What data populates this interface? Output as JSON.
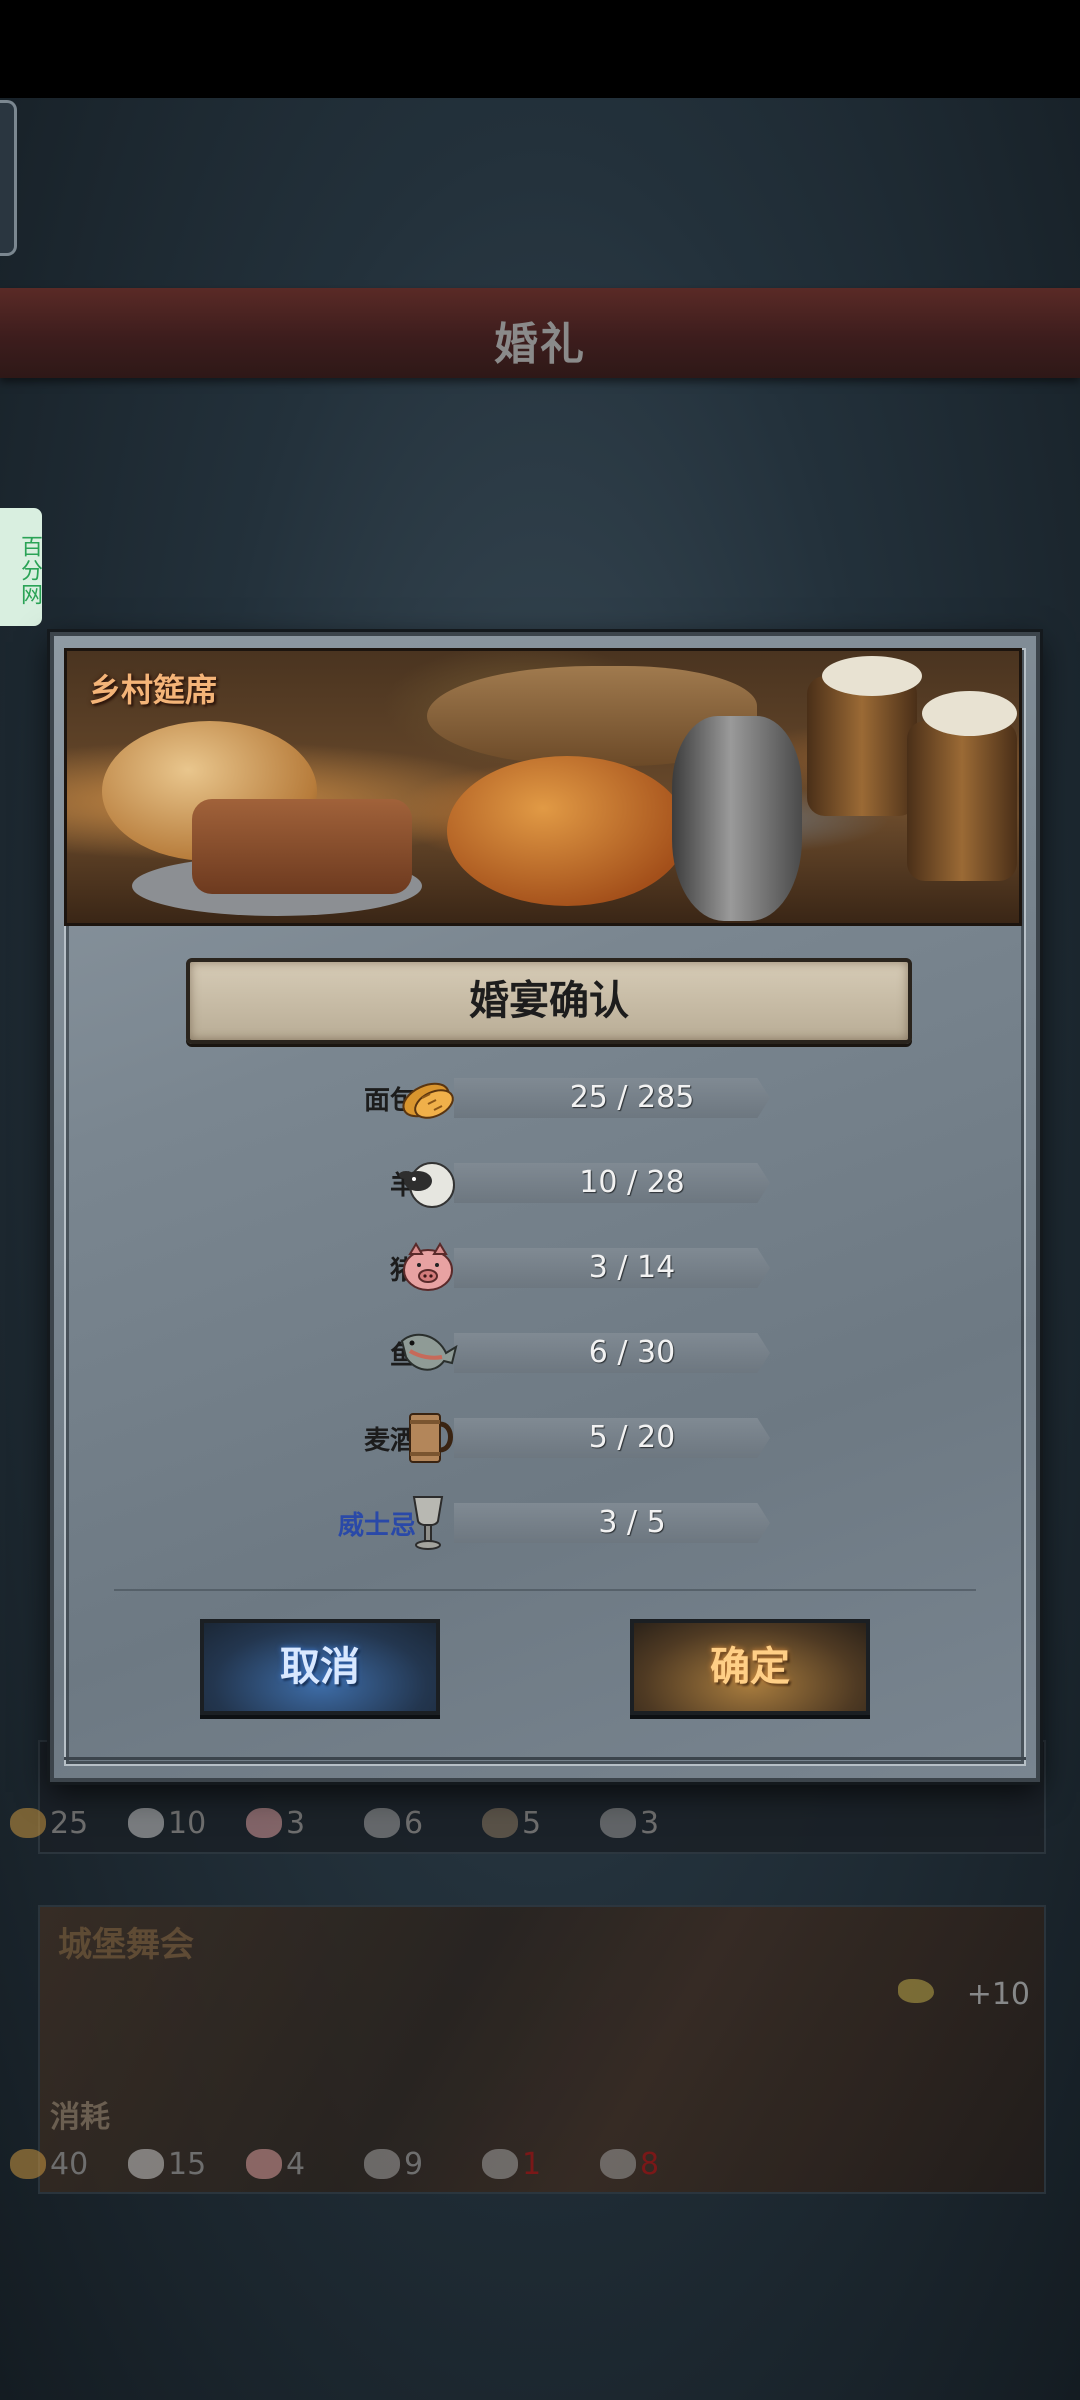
{
  "header": {
    "title": "婚礼"
  },
  "side_badge": {
    "text": "百分网"
  },
  "dialog": {
    "banner_label": "乡村筵席",
    "title": "婚宴确认",
    "resources": [
      {
        "label": "面包",
        "value": "25 / 285",
        "icon": "bread-icon",
        "color": "#1c1c1c"
      },
      {
        "label": "羊",
        "value": "10 / 28",
        "icon": "sheep-icon",
        "color": "#1c1c1c"
      },
      {
        "label": "猪",
        "value": "3 / 14",
        "icon": "pig-icon",
        "color": "#1c1c1c"
      },
      {
        "label": "鱼",
        "value": "6 / 30",
        "icon": "fish-icon",
        "color": "#1c1c1c"
      },
      {
        "label": "麦酒",
        "value": "5 / 20",
        "icon": "ale-mug-icon",
        "color": "#1c1c1c"
      },
      {
        "label": "威士忌",
        "value": "3 / 5",
        "icon": "goblet-icon",
        "color": "#2a49a8"
      }
    ],
    "cancel_label": "取消",
    "confirm_label": "确定"
  },
  "background_cards": {
    "card1_costs": [
      "25",
      "10",
      "3",
      "6",
      "5",
      "3"
    ],
    "card2": {
      "title": "城堡舞会",
      "consume_label": "消耗",
      "bonus": "+10",
      "costs": [
        "40",
        "15",
        "4",
        "9",
        "1",
        "8"
      ]
    }
  }
}
